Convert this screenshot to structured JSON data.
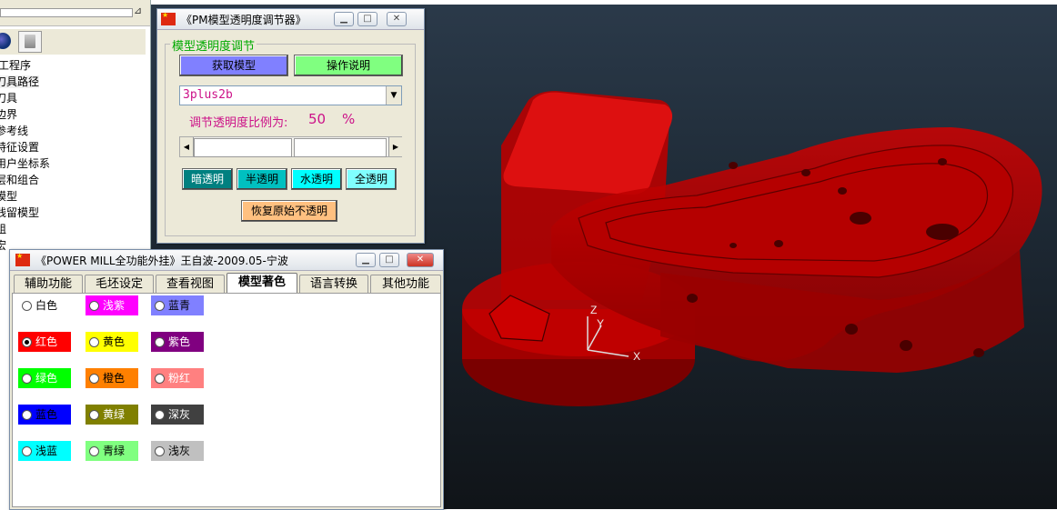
{
  "explorer": {
    "items": [
      "工程序",
      "刀具路径",
      "刀具",
      "边界",
      "参考线",
      "特征设置",
      "用户坐标系",
      "层和组合",
      "模型",
      "残留模型",
      "组",
      "宏"
    ]
  },
  "transparency_dialog": {
    "title": "《PM模型透明度调节器》",
    "group_label": "模型透明度调节",
    "get_model_label": "获取模型",
    "instructions_label": "操作说明",
    "model_selected": "3plus2b",
    "ratio_label": "调节透明度比例为:",
    "ratio_value": "50",
    "ratio_unit": "%",
    "presets": [
      "暗透明",
      "半透明",
      "水透明",
      "全透明"
    ],
    "restore_label": "恢复原始不透明",
    "get_model_color": "#8080ff",
    "instructions_color": "#80ff80",
    "restore_color": "#ffc080"
  },
  "main_window": {
    "title": "《POWER MILL全功能外挂》王自波-2009.05-宁波",
    "tabs": [
      "辅助功能",
      "毛坯设定",
      "查看视图",
      "模型著色",
      "语言转换",
      "其他功能"
    ],
    "active_tab": "模型著色",
    "colors": [
      {
        "label": "白色",
        "color": "#ffffff",
        "text_color": "#000000",
        "checked": false
      },
      {
        "label": "浅紫",
        "color": "#ff00ff",
        "text_color": "#ffffff",
        "checked": false
      },
      {
        "label": "蓝青",
        "color": "#8080ff",
        "text_color": "#000000",
        "checked": false
      },
      {
        "label": "红色",
        "color": "#ff0000",
        "text_color": "#ffffff",
        "checked": true
      },
      {
        "label": "黄色",
        "color": "#ffff00",
        "text_color": "#000000",
        "checked": false
      },
      {
        "label": "紫色",
        "color": "#800080",
        "text_color": "#ffffff",
        "checked": false
      },
      {
        "label": "绿色",
        "color": "#00ff00",
        "text_color": "#ffffff",
        "checked": false
      },
      {
        "label": "橙色",
        "color": "#ff8000",
        "text_color": "#000000",
        "checked": false
      },
      {
        "label": "粉红",
        "color": "#ff8080",
        "text_color": "#ffffff",
        "checked": false
      },
      {
        "label": "蓝色",
        "color": "#0000ff",
        "text_color": "#000000",
        "checked": false
      },
      {
        "label": "黄绿",
        "color": "#808000",
        "text_color": "#ffffff",
        "checked": false
      },
      {
        "label": "深灰",
        "color": "#404040",
        "text_color": "#ffffff",
        "checked": false
      },
      {
        "label": "浅蓝",
        "color": "#00ffff",
        "text_color": "#000000",
        "checked": false
      },
      {
        "label": "青绿",
        "color": "#80ff80",
        "text_color": "#000000",
        "checked": false
      },
      {
        "label": "浅灰",
        "color": "#c0c0c0",
        "text_color": "#000000",
        "checked": false
      }
    ]
  },
  "viewport": {
    "axis_x": "X",
    "axis_y": "Y",
    "axis_z": "Z",
    "model_color": "#cc0000"
  }
}
